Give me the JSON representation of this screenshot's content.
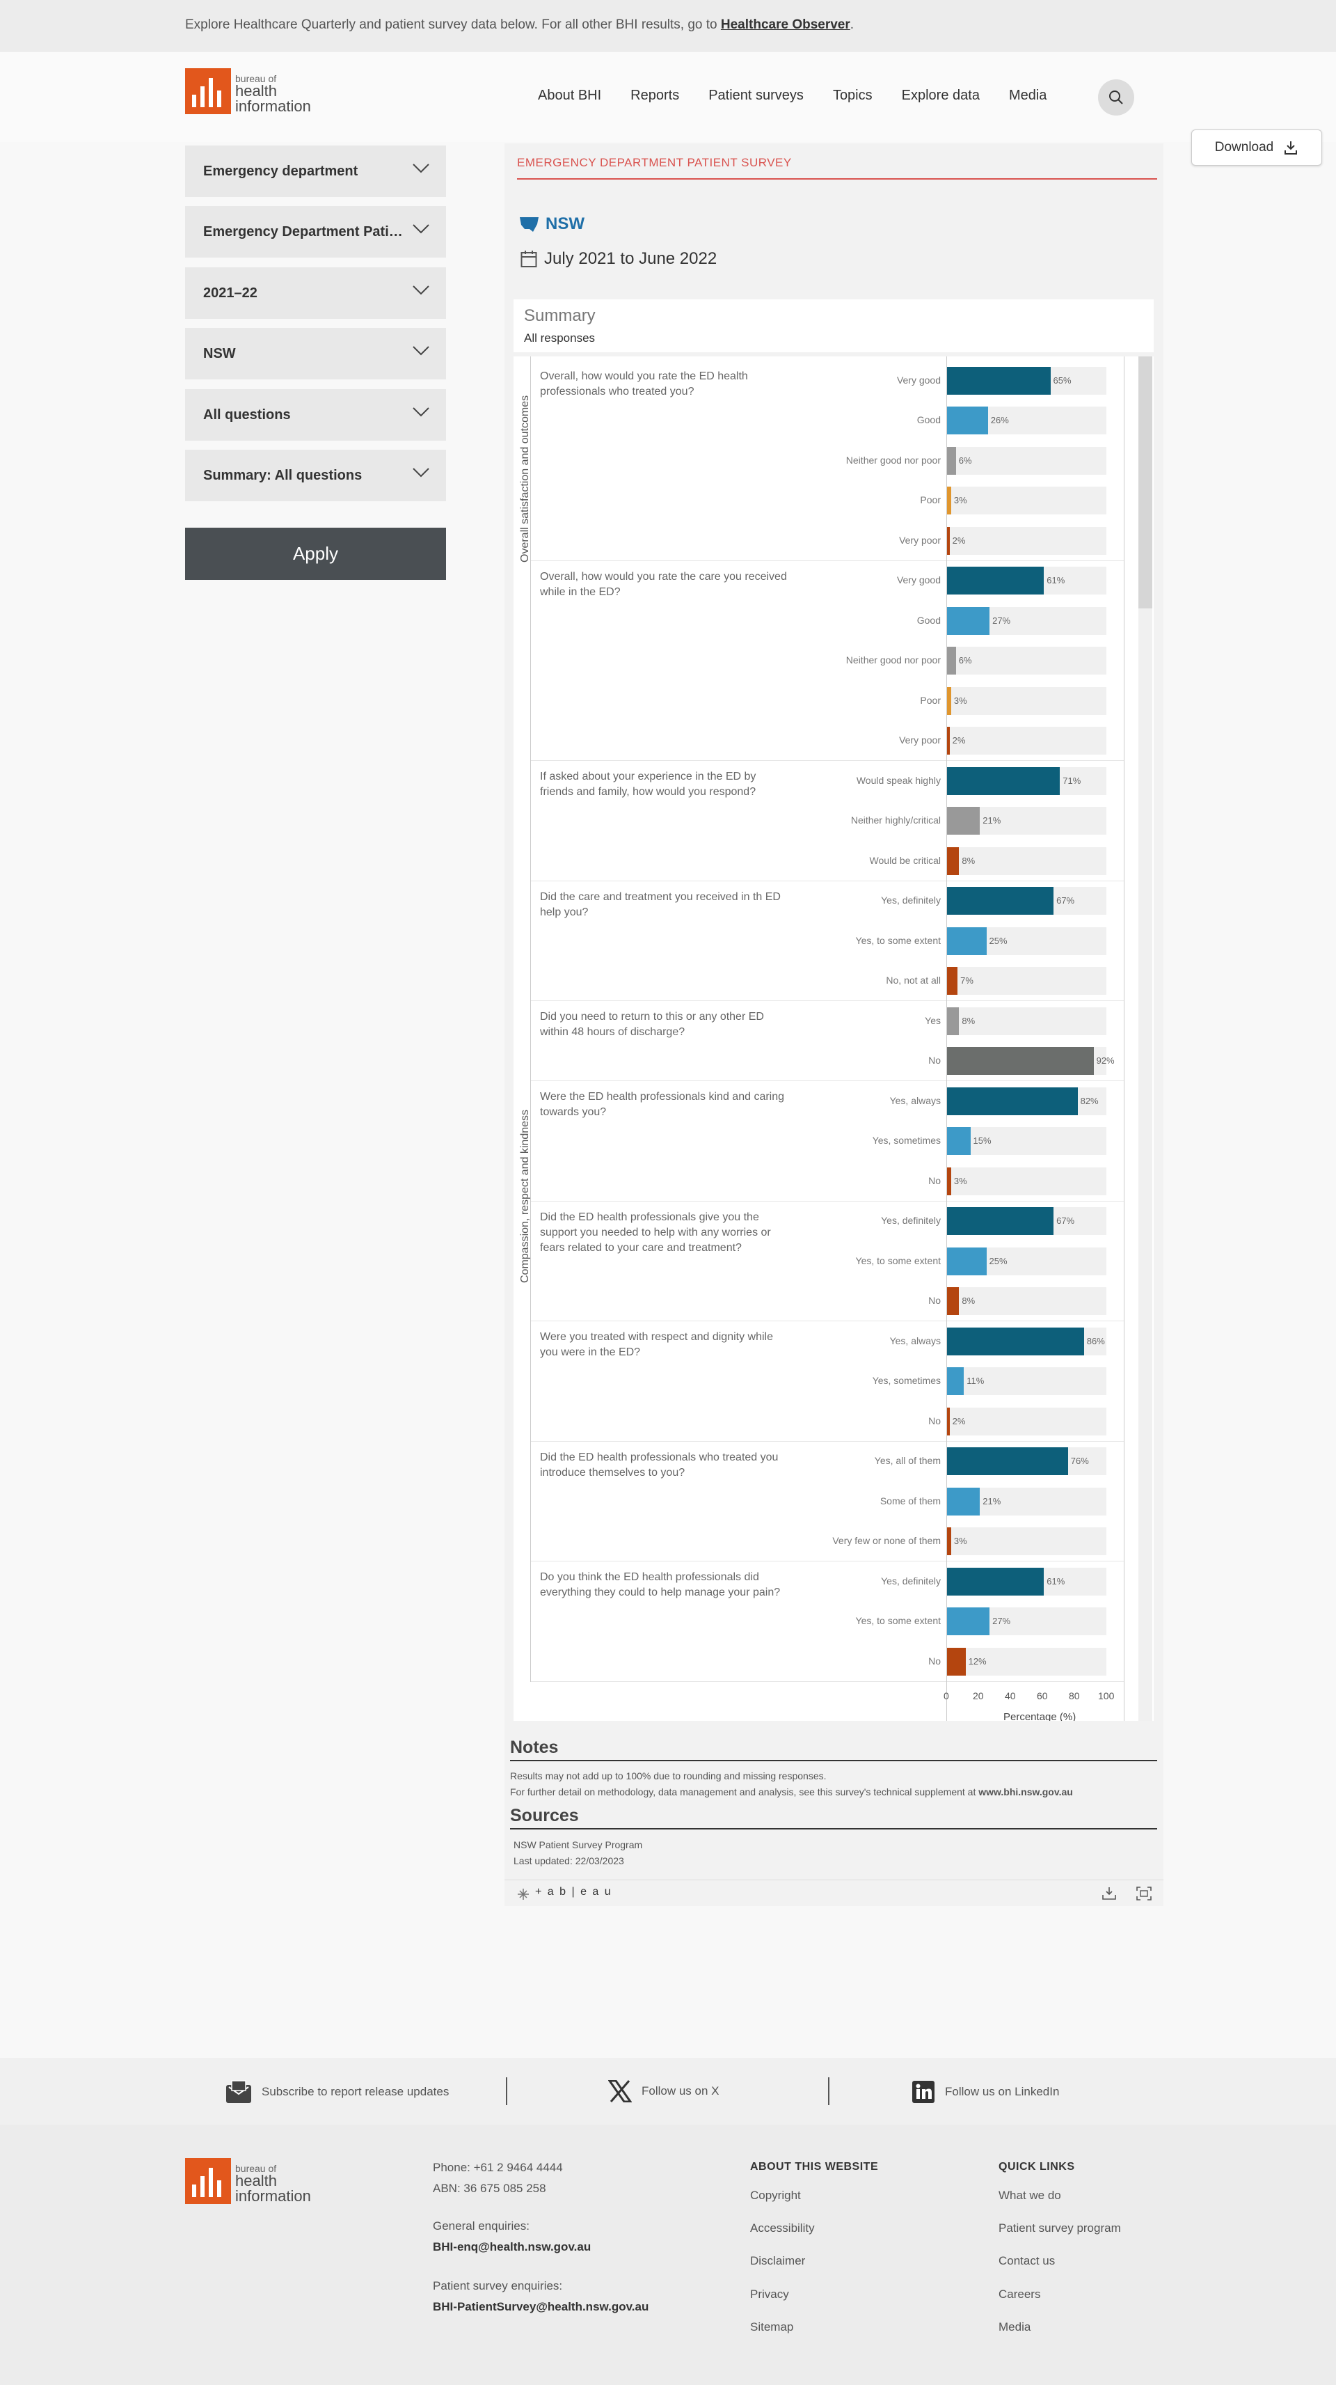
{
  "banner": {
    "text": "Explore Healthcare Quarterly and patient survey data below. For all other BHI results, go to ",
    "link": "Healthcare Observer",
    "tail": "."
  },
  "logo": {
    "small": "bureau of",
    "line1": "health",
    "line2": "information"
  },
  "nav": [
    "About BHI",
    "Reports",
    "Patient surveys",
    "Topics",
    "Explore data",
    "Media"
  ],
  "download": "Download",
  "filters": [
    "Emergency department",
    "Emergency Department Patient Survey",
    "2021–22",
    "NSW",
    "All questions",
    "Summary: All questions"
  ],
  "apply": "Apply",
  "viz": {
    "survey_title": "EMERGENCY DEPARTMENT PATIENT SURVEY",
    "region": "NSW",
    "period": "July 2021 to June 2022",
    "summary_title": "Summary",
    "summary_sub": "All responses"
  },
  "chart_data": {
    "type": "bar",
    "orientation": "horizontal",
    "xlabel": "Percentage (%)",
    "xlim": [
      0,
      100
    ],
    "xticks": [
      0,
      20,
      40,
      60,
      80,
      100
    ],
    "sections": [
      {
        "name": "Overall satisfaction and outcomes",
        "questions": [
          {
            "question": "Overall, how would you rate the ED health professionals who treated you?",
            "responses": [
              {
                "label": "Very good",
                "value": 65,
                "color": "#0d5f7a"
              },
              {
                "label": "Good",
                "value": 26,
                "color": "#3d9ac8"
              },
              {
                "label": "Neither good nor poor",
                "value": 6,
                "color": "#999999"
              },
              {
                "label": "Poor",
                "value": 3,
                "color": "#e0962e"
              },
              {
                "label": "Very poor",
                "value": 2,
                "color": "#b4450f"
              }
            ]
          },
          {
            "question": "Overall, how would you rate the care you received while in the ED?",
            "responses": [
              {
                "label": "Very good",
                "value": 61,
                "color": "#0d5f7a"
              },
              {
                "label": "Good",
                "value": 27,
                "color": "#3d9ac8"
              },
              {
                "label": "Neither good nor poor",
                "value": 6,
                "color": "#999999"
              },
              {
                "label": "Poor",
                "value": 3,
                "color": "#e0962e"
              },
              {
                "label": "Very poor",
                "value": 2,
                "color": "#b4450f"
              }
            ]
          },
          {
            "question": "If asked about your experience in the ED by friends and family, how would you respond?",
            "responses": [
              {
                "label": "Would speak highly",
                "value": 71,
                "color": "#0d5f7a"
              },
              {
                "label": "Neither highly/critical",
                "value": 21,
                "color": "#999999"
              },
              {
                "label": "Would be critical",
                "value": 8,
                "color": "#b4450f"
              }
            ]
          },
          {
            "question": "Did the care and treatment you received in th ED help you?",
            "responses": [
              {
                "label": "Yes, definitely",
                "value": 67,
                "color": "#0d5f7a"
              },
              {
                "label": "Yes, to some extent",
                "value": 25,
                "color": "#3d9ac8"
              },
              {
                "label": "No, not at all",
                "value": 7,
                "color": "#b4450f"
              }
            ]
          },
          {
            "question": "Did you need to return to this or any other ED within 48 hours of discharge?",
            "responses": [
              {
                "label": "Yes",
                "value": 8,
                "color": "#999999"
              },
              {
                "label": "No",
                "value": 92,
                "color": "#6b6e6c"
              }
            ]
          }
        ]
      },
      {
        "name": "Compassion, respect and kindness",
        "questions": [
          {
            "question": "Were the ED health professionals kind and caring towards you?",
            "responses": [
              {
                "label": "Yes, always",
                "value": 82,
                "color": "#0d5f7a"
              },
              {
                "label": "Yes, sometimes",
                "value": 15,
                "color": "#3d9ac8"
              },
              {
                "label": "No",
                "value": 3,
                "color": "#b4450f"
              }
            ]
          },
          {
            "question": "Did the ED health professionals give you the support you needed to help with any worries or fears related to your care and treatment?",
            "responses": [
              {
                "label": "Yes, definitely",
                "value": 67,
                "color": "#0d5f7a"
              },
              {
                "label": "Yes, to some extent",
                "value": 25,
                "color": "#3d9ac8"
              },
              {
                "label": "No",
                "value": 8,
                "color": "#b4450f"
              }
            ]
          },
          {
            "question": "Were you treated with respect and dignity while you were in the ED?",
            "responses": [
              {
                "label": "Yes, always",
                "value": 86,
                "color": "#0d5f7a"
              },
              {
                "label": "Yes, sometimes",
                "value": 11,
                "color": "#3d9ac8"
              },
              {
                "label": "No",
                "value": 2,
                "color": "#b4450f"
              }
            ]
          },
          {
            "question": "Did the ED health professionals who treated you introduce themselves to you?",
            "responses": [
              {
                "label": "Yes, all of them",
                "value": 76,
                "color": "#0d5f7a"
              },
              {
                "label": "Some of them",
                "value": 21,
                "color": "#3d9ac8"
              },
              {
                "label": "Very few or none of them",
                "value": 3,
                "color": "#b4450f"
              }
            ]
          },
          {
            "question": "Do you think the ED health professionals did everything they could to help manage your pain?",
            "responses": [
              {
                "label": "Yes, definitely",
                "value": 61,
                "color": "#0d5f7a"
              },
              {
                "label": "Yes, to some extent",
                "value": 27,
                "color": "#3d9ac8"
              },
              {
                "label": "No",
                "value": 12,
                "color": "#b4450f"
              }
            ]
          }
        ]
      }
    ]
  },
  "notes": {
    "title": "Notes",
    "line1": "Results may not add up to 100% due to rounding and missing responses.",
    "line2": "For further detail on methodology, data management and analysis, see this survey's technical supplement at ",
    "link": "www.bhi.nsw.gov.au"
  },
  "sources": {
    "title": "Sources",
    "line1": "NSW Patient Survey Program",
    "line2": "Last updated: 22/03/2023"
  },
  "tableau": "+ a b | e a u",
  "social": {
    "subscribe": "Subscribe to report release updates",
    "x": "Follow us on X",
    "linkedin": "Follow us on LinkedIn"
  },
  "footer": {
    "phone": "Phone: +61 2 9464 4444",
    "abn": "ABN: 36 675 085 258",
    "general_label": "General enquiries:",
    "general_email": "BHI-enq@health.nsw.gov.au",
    "survey_label": "Patient survey enquiries:",
    "survey_email": "BHI-PatientSurvey@health.nsw.gov.au",
    "about_title": "ABOUT THIS WEBSITE",
    "about_links": [
      "Copyright",
      "Accessibility",
      "Disclaimer",
      "Privacy",
      "Sitemap"
    ],
    "quick_title": "QUICK LINKS",
    "quick_links": [
      "What we do",
      "Patient survey program",
      "Contact us",
      "Careers",
      "Media"
    ]
  }
}
